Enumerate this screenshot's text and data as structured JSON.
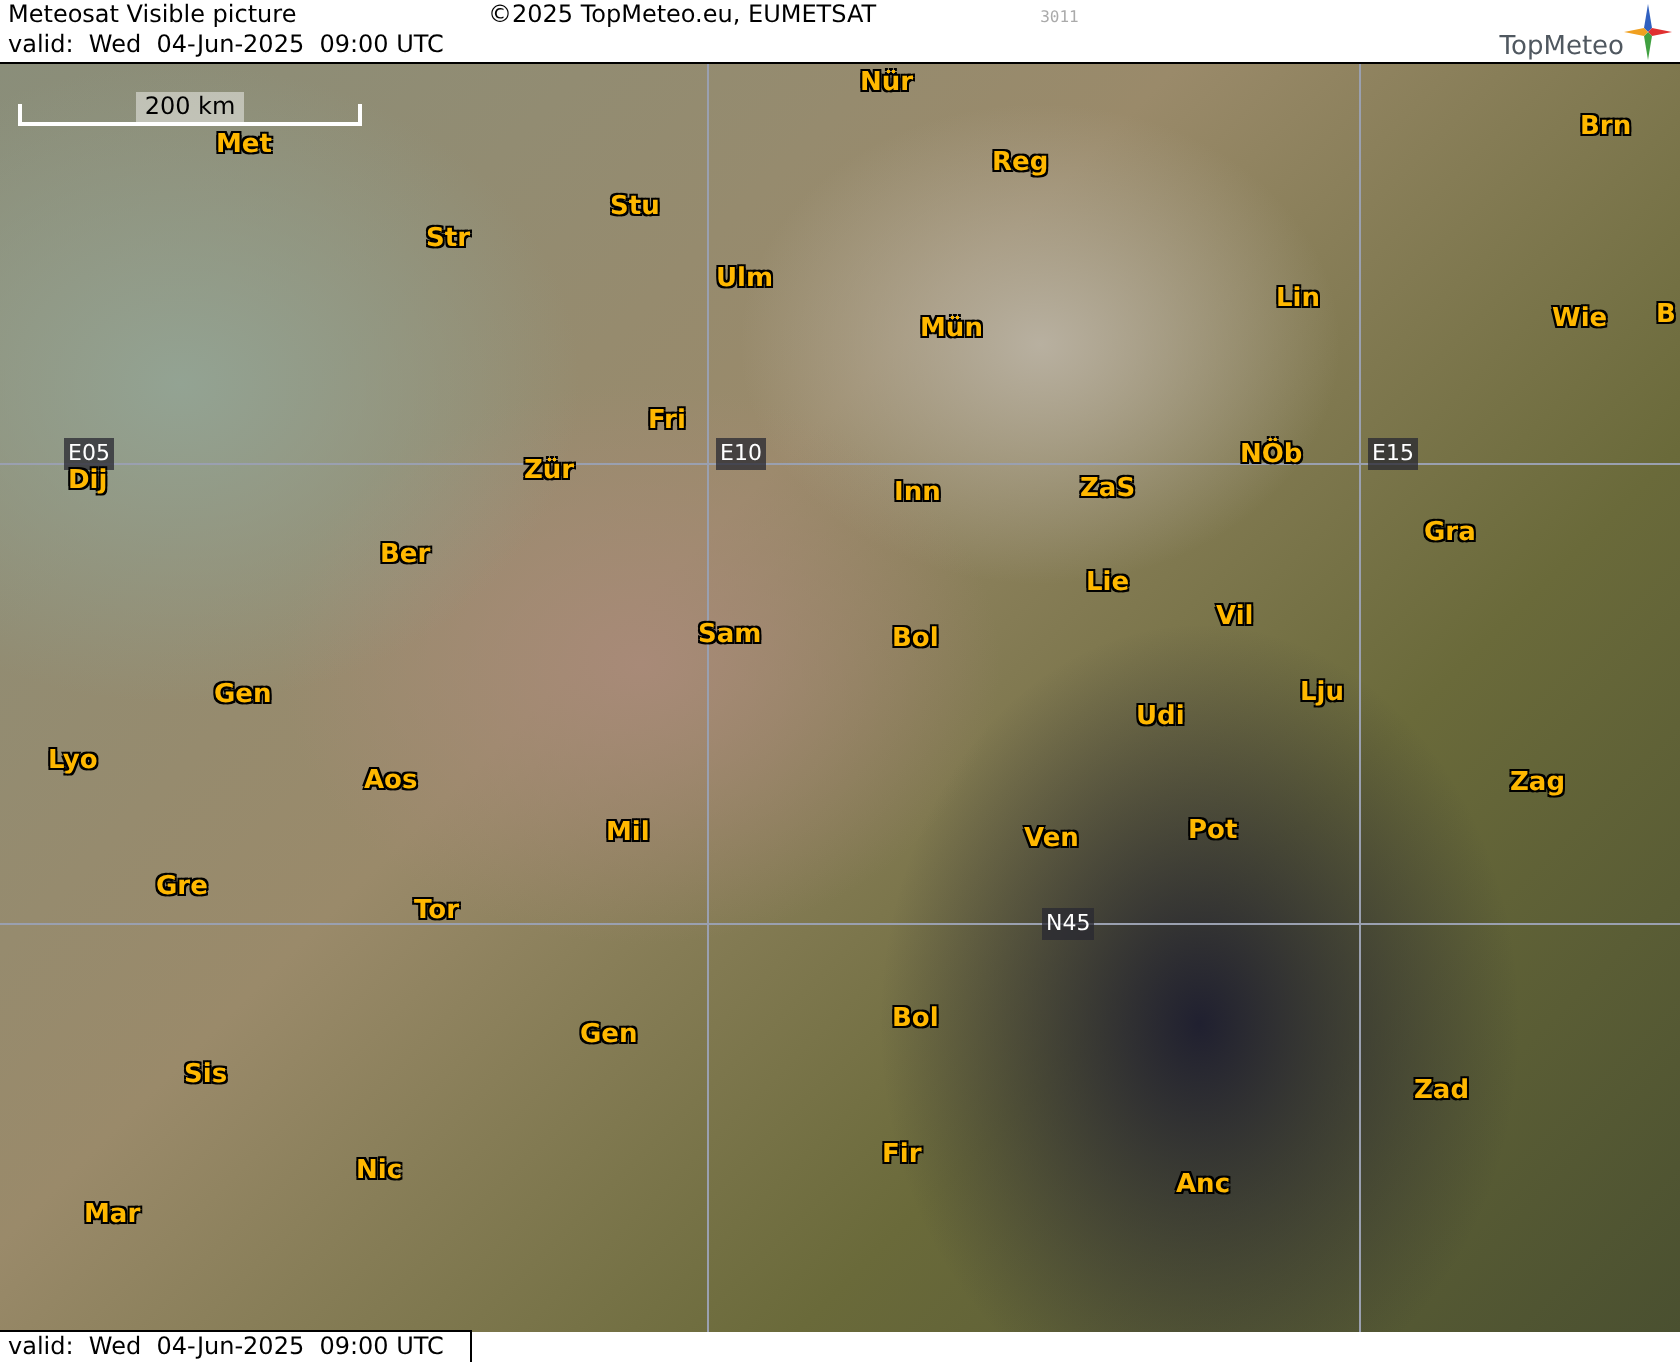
{
  "header": {
    "title": "Meteosat Visible picture",
    "copyright": "©2025 TopMeteo.eu, EUMETSAT",
    "code": "3011",
    "valid": "valid:  Wed  04-Jun-2025  09:00 UTC",
    "logo_text": "TopMeteo"
  },
  "map": {
    "scale": "200 km",
    "labels": [
      {
        "text": "Nür",
        "kind": "city"
      },
      {
        "text": "Reg",
        "kind": "city"
      },
      {
        "text": "Brn",
        "kind": "city"
      },
      {
        "text": "Met",
        "kind": "city"
      },
      {
        "text": "Stu",
        "kind": "city"
      },
      {
        "text": "Str",
        "kind": "city"
      },
      {
        "text": "Ulm",
        "kind": "city"
      },
      {
        "text": "Lin",
        "kind": "city"
      },
      {
        "text": "Mün",
        "kind": "city"
      },
      {
        "text": "Wie",
        "kind": "city"
      },
      {
        "text": "B",
        "kind": "city"
      },
      {
        "text": "Fri",
        "kind": "city"
      },
      {
        "text": "E05",
        "kind": "grid"
      },
      {
        "text": "E10",
        "kind": "grid"
      },
      {
        "text": "E15",
        "kind": "grid"
      },
      {
        "text": "Dij",
        "kind": "city"
      },
      {
        "text": "Zür",
        "kind": "city"
      },
      {
        "text": "Inn",
        "kind": "city"
      },
      {
        "text": "ZaS",
        "kind": "city"
      },
      {
        "text": "NÖb",
        "kind": "city"
      },
      {
        "text": "Gra",
        "kind": "city"
      },
      {
        "text": "Ber",
        "kind": "city"
      },
      {
        "text": "Lie",
        "kind": "city"
      },
      {
        "text": "Vil",
        "kind": "city"
      },
      {
        "text": "Sam",
        "kind": "city"
      },
      {
        "text": "Bol",
        "kind": "city"
      },
      {
        "text": "Lju",
        "kind": "city"
      },
      {
        "text": "Gen",
        "kind": "city"
      },
      {
        "text": "Udi",
        "kind": "city"
      },
      {
        "text": "Lyo",
        "kind": "city"
      },
      {
        "text": "Aos",
        "kind": "city"
      },
      {
        "text": "Zag",
        "kind": "city"
      },
      {
        "text": "Mil",
        "kind": "city"
      },
      {
        "text": "Ven",
        "kind": "city"
      },
      {
        "text": "Pot",
        "kind": "city"
      },
      {
        "text": "Gre",
        "kind": "city"
      },
      {
        "text": "Tor",
        "kind": "city"
      },
      {
        "text": "N45",
        "kind": "grid"
      },
      {
        "text": "Bol",
        "kind": "city"
      },
      {
        "text": "Gen",
        "kind": "city"
      },
      {
        "text": "Zad",
        "kind": "city"
      },
      {
        "text": "Sis",
        "kind": "city"
      },
      {
        "text": "Fir",
        "kind": "city"
      },
      {
        "text": "Nic",
        "kind": "city"
      },
      {
        "text": "Anc",
        "kind": "city"
      },
      {
        "text": "Mar",
        "kind": "city"
      }
    ]
  },
  "footer": {
    "valid": "valid:  Wed  04-Jun-2025  09:00 UTC"
  }
}
